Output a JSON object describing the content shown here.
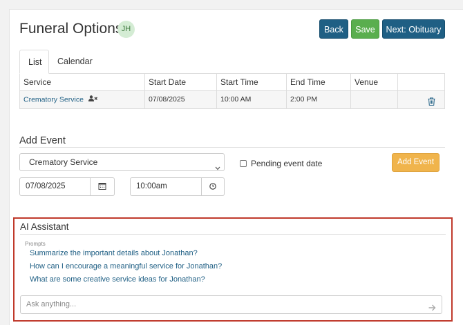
{
  "header": {
    "title": "Funeral Options",
    "initials": "JH",
    "back_label": "Back",
    "save_label": "Save",
    "next_label": "Next: Obituary"
  },
  "tabs": [
    {
      "label": "List",
      "active": true
    },
    {
      "label": "Calendar",
      "active": false
    }
  ],
  "table": {
    "columns": [
      "Service",
      "Start Date",
      "Start Time",
      "End Time",
      "Venue",
      ""
    ],
    "rows": [
      {
        "service": "Crematory Service",
        "start_date": "07/08/2025",
        "start_time": "10:00 AM",
        "end_time": "2:00 PM",
        "venue": ""
      }
    ]
  },
  "add_event": {
    "title": "Add Event",
    "service_select": "Crematory Service",
    "pending_label": "Pending event date",
    "pending_checked": false,
    "date_value": "07/08/2025",
    "time_value": "10:00am",
    "add_label": "Add Event"
  },
  "ai": {
    "title": "AI Assistant",
    "prompts_label": "Prompts",
    "prompts": [
      "Summarize the important details about Jonathan?",
      "How can I encourage a meaningful service for Jonathan?",
      "What are some creative service ideas for Jonathan?"
    ],
    "ask_placeholder": "Ask anything..."
  },
  "icons": {
    "service_row_icon": "person-x-icon",
    "row_action": "trash-icon",
    "date_addon": "calendar-icon",
    "time_addon": "clock-icon",
    "select_caret": "chevron-down-icon",
    "send": "arrow-right-icon"
  },
  "colors": {
    "primary": "#1f5f84",
    "success": "#5aae4e",
    "warning": "#f0b44c",
    "highlight_border": "#c0392b"
  }
}
